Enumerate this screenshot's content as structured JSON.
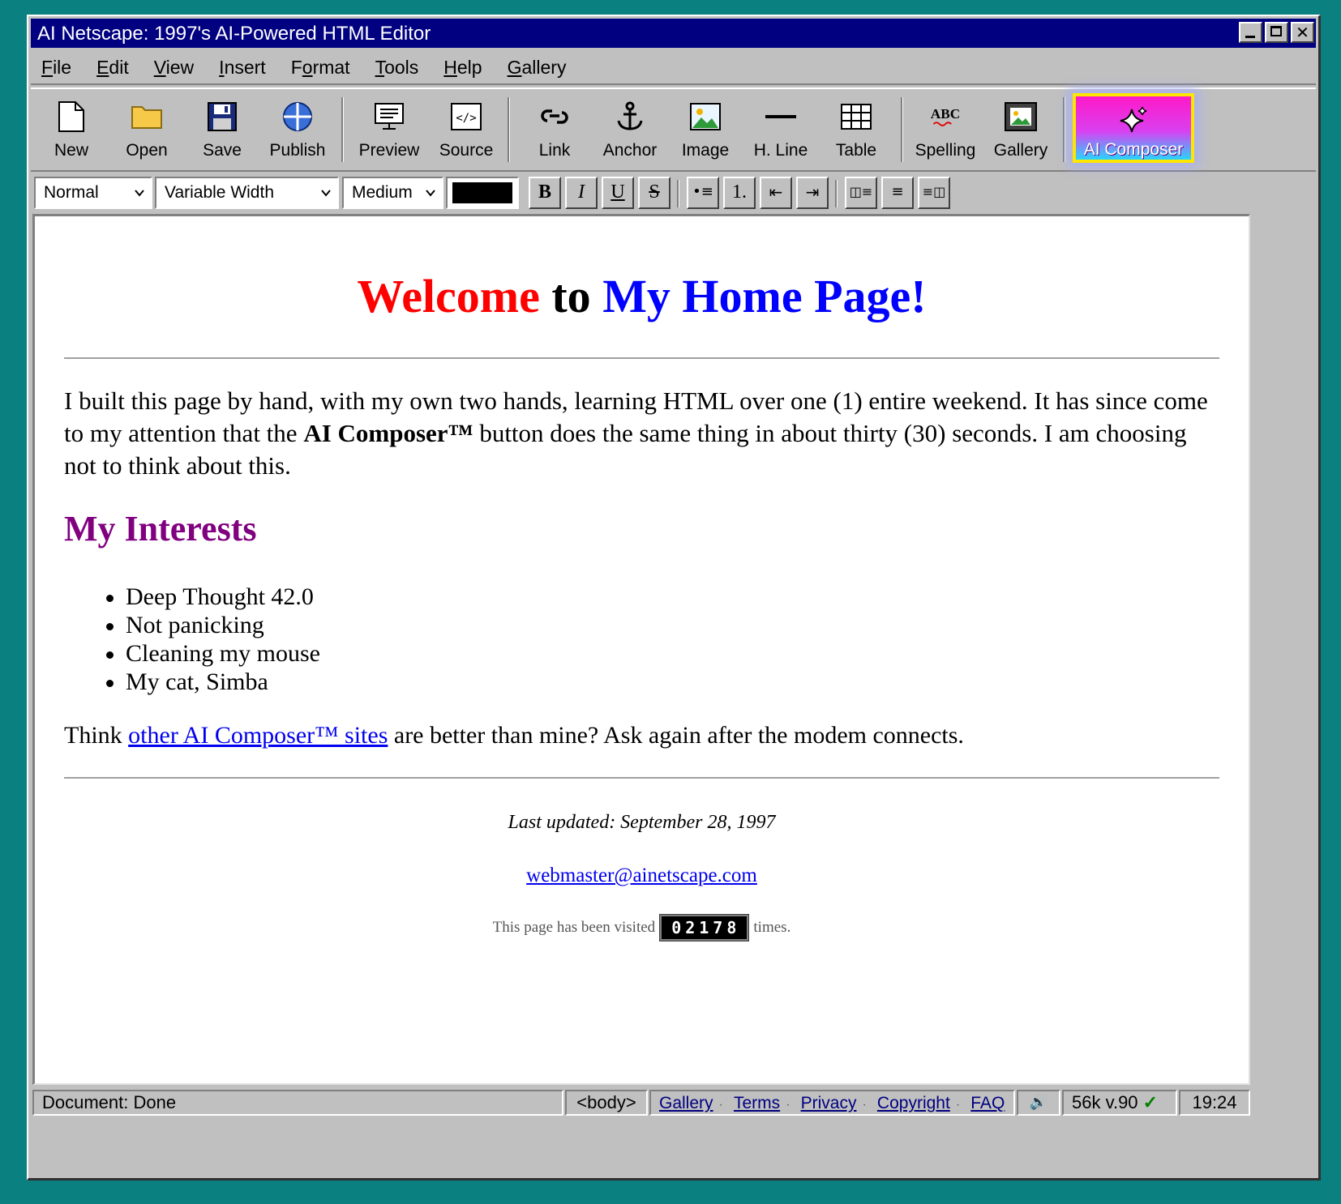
{
  "window": {
    "title": "AI Netscape: 1997's AI-Powered HTML Editor"
  },
  "menu": [
    {
      "pre": "",
      "key": "F",
      "post": "ile"
    },
    {
      "pre": "",
      "key": "E",
      "post": "dit"
    },
    {
      "pre": "",
      "key": "V",
      "post": "iew"
    },
    {
      "pre": "",
      "key": "I",
      "post": "nsert"
    },
    {
      "pre": "F",
      "key": "o",
      "post": "rmat"
    },
    {
      "pre": "",
      "key": "T",
      "post": "ools"
    },
    {
      "pre": "",
      "key": "H",
      "post": "elp"
    },
    {
      "pre": "",
      "key": "G",
      "post": "allery"
    }
  ],
  "toolbar": {
    "new": "New",
    "open": "Open",
    "save": "Save",
    "publish": "Publish",
    "preview": "Preview",
    "source": "Source",
    "link": "Link",
    "anchor": "Anchor",
    "image": "Image",
    "hline": "H. Line",
    "table": "Table",
    "spelling": "Spelling",
    "gallery": "Gallery",
    "ai_composer": "AI Composer",
    "spelling_glyph": "ABC",
    "source_glyph": "</>"
  },
  "format": {
    "paragraph_style": "Normal",
    "font": "Variable Width",
    "size": "Medium",
    "text_color": "#000000",
    "bold": "B",
    "italic": "I",
    "underline": "U",
    "strike": "S",
    "bullets": "•≡",
    "numbered": "1.",
    "outdent": "⇤",
    "indent": "⇥",
    "align_left": "◫≡",
    "align_center": "≡",
    "align_right": "≡◫"
  },
  "page": {
    "heading": {
      "part1": "Welcome",
      "part2": "to",
      "part3": "My Home Page!",
      "color1": "#ff0000",
      "color2": "#000000",
      "color3": "#0000ff"
    },
    "intro": {
      "before": "I built this page by hand, with my own two hands, learning HTML over one (1) entire weekend. It has since come to my attention that the ",
      "bold": "AI Composer™",
      "after": " button does the same thing in about thirty (30) seconds. I am choosing not to think about this."
    },
    "interests_heading": "My Interests",
    "interests": [
      "Deep Thought 42.0",
      "Not panicking",
      "Cleaning my mouse",
      "My cat, Simba"
    ],
    "think": {
      "before": "Think ",
      "link": "other AI Composer™ sites",
      "after": " are better than mine? Ask again after the modem connects."
    },
    "updated": "Last updated: September 28, 1997",
    "email": "webmaster@ainetscape.com",
    "visits_before": "This page has been visited",
    "counter": "02178",
    "visits_after": "times."
  },
  "status": {
    "document": "Document: Done",
    "tag": "<body>",
    "links": [
      "Gallery",
      "Terms",
      "Privacy",
      "Copyright",
      "FAQ"
    ],
    "sound_glyph": "🔊",
    "modem": "56k v.90",
    "check": "✓",
    "time": "19:24"
  }
}
